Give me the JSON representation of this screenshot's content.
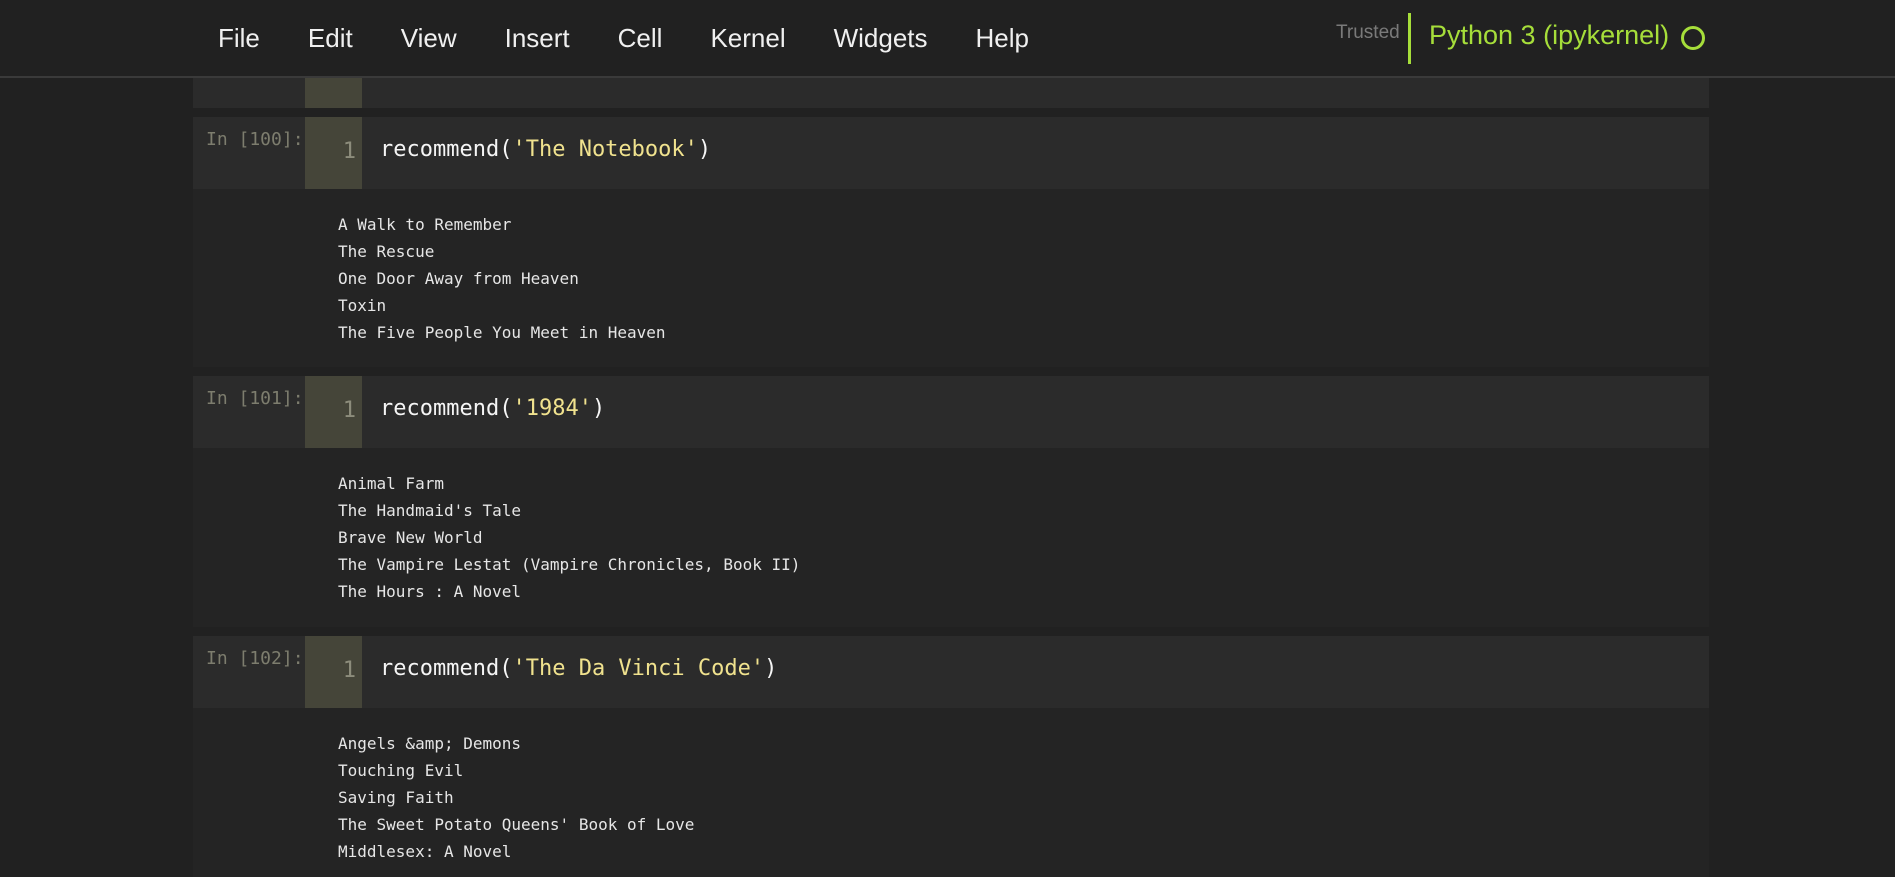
{
  "menu": {
    "items": [
      "File",
      "Edit",
      "View",
      "Insert",
      "Cell",
      "Kernel",
      "Widgets",
      "Help"
    ]
  },
  "status": {
    "trusted": "Trusted",
    "kernel": "Python 3 (ipykernel)"
  },
  "cells": [
    {
      "prompt": "In [100]:",
      "line_number": "1",
      "func": "recommend",
      "arg": "'The Notebook'",
      "output": [
        "A Walk to Remember",
        "The Rescue",
        "One Door Away from Heaven",
        "Toxin",
        "The Five People You Meet in Heaven"
      ]
    },
    {
      "prompt": "In [101]:",
      "line_number": "1",
      "func": "recommend",
      "arg": "'1984'",
      "output": [
        "Animal Farm",
        "The Handmaid's Tale",
        "Brave New World",
        "The Vampire Lestat (Vampire Chronicles, Book II)",
        "The Hours : A Novel"
      ]
    },
    {
      "prompt": "In [102]:",
      "line_number": "1",
      "func": "recommend",
      "arg": "'The Da Vinci Code'",
      "output": [
        "Angels &amp; Demons",
        "Touching Evil",
        "Saving Faith",
        "The Sweet Potato Queens' Book of Love",
        "Middlesex: A Novel"
      ]
    }
  ],
  "colors": {
    "background": "#212121",
    "kernel_accent": "#a6de3a",
    "string": "#f0e28e",
    "gutter": "#454539"
  }
}
